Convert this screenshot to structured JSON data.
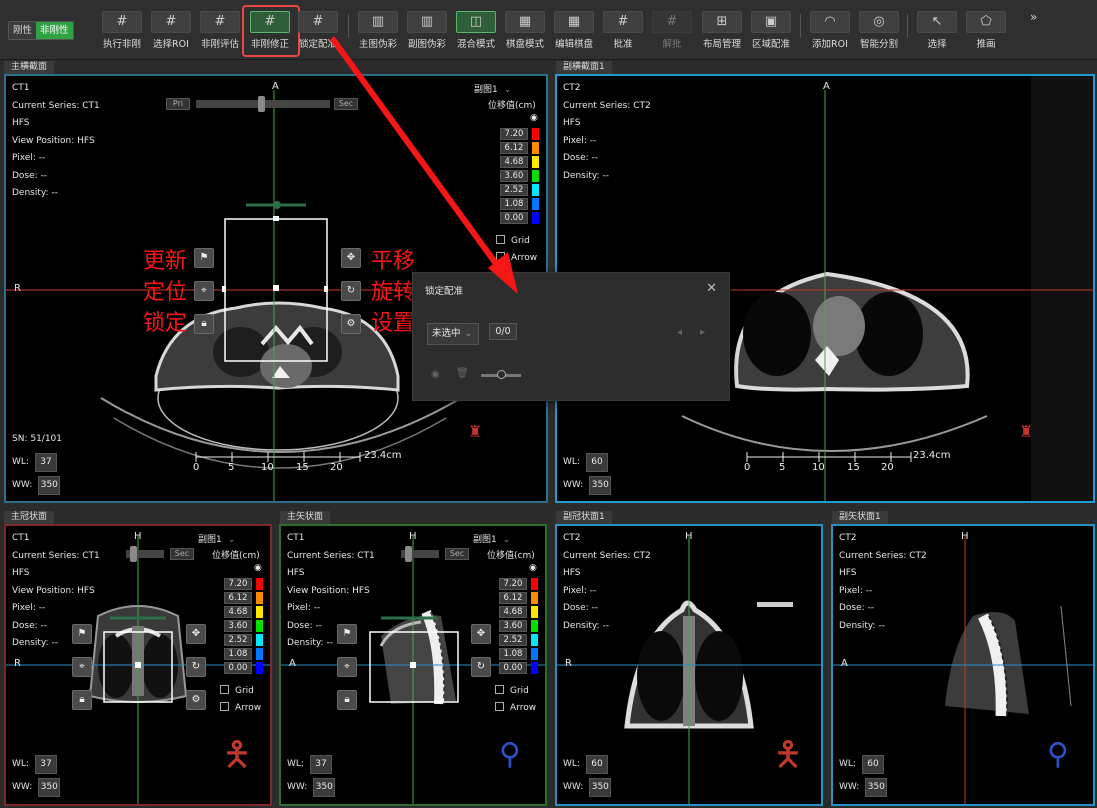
{
  "toolbar": {
    "mode_rigid": "刚性",
    "mode_nonrigid": "非刚性",
    "buttons": [
      {
        "label": "执行非刚",
        "icon": "grid-icon"
      },
      {
        "label": "选择ROI",
        "icon": "grid-icon"
      },
      {
        "label": "非刚评估",
        "icon": "grid-icon"
      },
      {
        "label": "非刚修正",
        "icon": "grid-icon"
      },
      {
        "label": "锁定配准",
        "icon": "grid-icon"
      },
      {
        "label": "主图伪彩",
        "icon": "bars-icon"
      },
      {
        "label": "副图伪彩",
        "icon": "bars-icon"
      },
      {
        "label": "混合模式",
        "icon": "blend-icon"
      },
      {
        "label": "棋盘模式",
        "icon": "checker-icon"
      },
      {
        "label": "编辑棋盘",
        "icon": "checker-edit-icon"
      },
      {
        "label": "批准",
        "icon": "grid-icon"
      },
      {
        "label": "解批",
        "icon": "grid-icon"
      },
      {
        "label": "布局管理",
        "icon": "layout-icon"
      },
      {
        "label": "区域配准",
        "icon": "region-icon"
      },
      {
        "label": "添加ROI",
        "icon": "roi-icon"
      },
      {
        "label": "智能分割",
        "icon": "segment-icon"
      },
      {
        "label": "选择",
        "icon": "cursor-icon"
      },
      {
        "label": "推画",
        "icon": "push-icon"
      }
    ],
    "more": "»"
  },
  "colors": {
    "highlight": "#e8473f",
    "accent_green": "#2fa344"
  },
  "panes": {
    "main_axial": {
      "title": "主横截面",
      "series": "CT1",
      "current_series": "Current Series: CT1",
      "hfs": "HFS",
      "view_position": "View Position: HFS",
      "pixel": "Pixel: --",
      "dose": "Dose: --",
      "density": "Density: --",
      "top_label": "A",
      "left_label": "R",
      "sub_image": "副图1",
      "legend_title": "位移值(cm)",
      "legend": [
        "7.20",
        "6.12",
        "4.68",
        "3.60",
        "2.52",
        "1.08",
        "0.00"
      ],
      "legend_colors": [
        "#ff0000",
        "#ff8a00",
        "#ffe600",
        "#00e000",
        "#00e6ff",
        "#0077ff",
        "#0000ff"
      ],
      "grid": "Grid",
      "arrow": "Arrow",
      "slider_pri": "Pri",
      "slider_sec": "Sec",
      "sn": "SN: 51/101",
      "wl_label": "WL:",
      "wl": "37",
      "ww_label": "WW:",
      "ww": "350",
      "scale_ticks": [
        "0",
        "5",
        "10",
        "15",
        "20"
      ],
      "scale_len": "23.4cm"
    },
    "sec_axial": {
      "title": "副横截面1",
      "series": "CT2",
      "current_series": "Current Series: CT2",
      "hfs": "HFS",
      "pixel": "Pixel: --",
      "dose": "Dose: --",
      "density": "Density: --",
      "top_label": "A",
      "wl_label": "WL:",
      "wl": "60",
      "ww_label": "WW:",
      "ww": "350",
      "scale_ticks": [
        "0",
        "5",
        "10",
        "15",
        "20"
      ],
      "scale_len": "23.4cm"
    },
    "main_coronal": {
      "title": "主冠状面",
      "series": "CT1",
      "current_series": "Current Series: CT1",
      "hfs": "HFS",
      "view_position": "View Position: HFS",
      "pixel": "Pixel: --",
      "dose": "Dose: --",
      "density": "Density: --",
      "top_label": "H",
      "left_label": "R",
      "sub_image": "副图1",
      "legend_title": "位移值(cm)",
      "grid": "Grid",
      "arrow": "Arrow",
      "slider_sec": "Sec",
      "wl_label": "WL:",
      "wl": "37",
      "ww_label": "WW:",
      "ww": "350"
    },
    "main_sagittal": {
      "title": "主矢状面",
      "series": "CT1",
      "current_series": "Current Series: CT1",
      "hfs": "HFS",
      "view_position": "View Position: HFS",
      "pixel": "Pixel: --",
      "dose": "Dose: --",
      "density": "Density: --",
      "top_label": "H",
      "left_label": "A",
      "sub_image": "副图1",
      "legend_title": "位移值(cm)",
      "grid": "Grid",
      "arrow": "Arrow",
      "slider_sec": "Sec",
      "wl_label": "WL:",
      "wl": "37",
      "ww_label": "WW:",
      "ww": "350"
    },
    "sec_coronal": {
      "title": "副冠状面1",
      "series": "CT2",
      "current_series": "Current Series: CT2",
      "hfs": "HFS",
      "pixel": "Pixel: --",
      "dose": "Dose: --",
      "density": "Density: --",
      "top_label": "H",
      "left_label": "R",
      "wl_label": "WL:",
      "wl": "60",
      "ww_label": "WW:",
      "ww": "350"
    },
    "sec_sagittal": {
      "title": "副矢状面1",
      "series": "CT2",
      "current_series": "Current Series: CT2",
      "hfs": "HFS",
      "pixel": "Pixel: --",
      "dose": "Dose: --",
      "density": "Density: --",
      "top_label": "H",
      "left_label": "A",
      "wl_label": "WL:",
      "wl": "60",
      "ww_label": "WW:",
      "ww": "350"
    }
  },
  "annotations": {
    "left": [
      "更新",
      "定位",
      "锁定"
    ],
    "right": [
      "平移",
      "旋转",
      "设置"
    ]
  },
  "dialog": {
    "title": "锁定配准",
    "close": "✕",
    "select_value": "未选中",
    "count": "0/0"
  }
}
